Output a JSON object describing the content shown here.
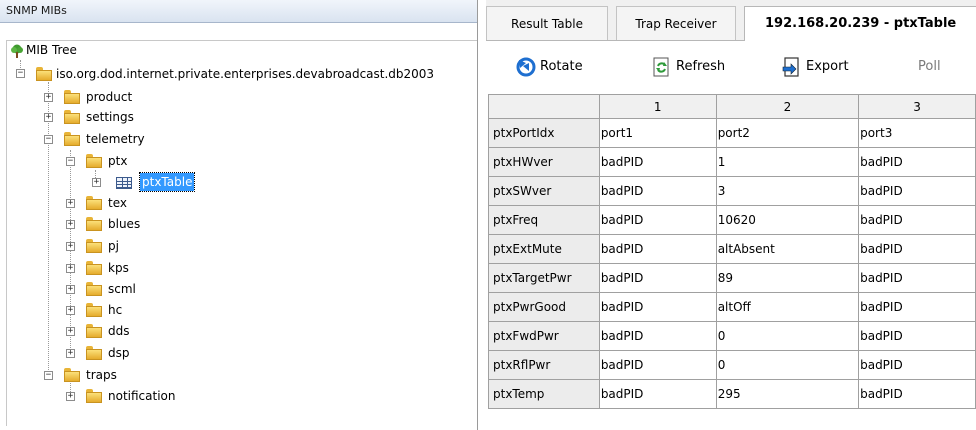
{
  "left_panel": {
    "title": "SNMP MIBs",
    "root_label": "MIB Tree",
    "tree": [
      {
        "label": "iso.org.dod.internet.private.enterprises.devabroadcast.db2003",
        "expander": "−"
      },
      {
        "label": "product",
        "expander": "+"
      },
      {
        "label": "settings",
        "expander": "+"
      },
      {
        "label": "telemetry",
        "expander": "−"
      },
      {
        "label": "ptx",
        "expander": "−"
      },
      {
        "label": "ptxTable",
        "expander": "+",
        "selected": true
      },
      {
        "label": "tex",
        "expander": "+"
      },
      {
        "label": "blues",
        "expander": "+"
      },
      {
        "label": "pj",
        "expander": "+"
      },
      {
        "label": "kps",
        "expander": "+"
      },
      {
        "label": "scml",
        "expander": "+"
      },
      {
        "label": "hc",
        "expander": "+"
      },
      {
        "label": "dds",
        "expander": "+"
      },
      {
        "label": "dsp",
        "expander": "+"
      },
      {
        "label": "traps",
        "expander": "−"
      },
      {
        "label": "notification",
        "expander": "+"
      }
    ]
  },
  "tabs": [
    {
      "label": "Result Table",
      "active": false
    },
    {
      "label": "Trap Receiver",
      "active": false
    },
    {
      "label": "192.168.20.239 - ptxTable",
      "active": true
    }
  ],
  "toolbar": {
    "rotate_label": "Rotate",
    "refresh_label": "Refresh",
    "export_label": "Export",
    "poll_label": "Poll"
  },
  "icons": {
    "tree_root": "tree-icon",
    "folder": "folder-icon",
    "table": "table-icon",
    "rotate": "rotate-icon",
    "refresh": "refresh-icon",
    "export": "export-icon"
  },
  "colors": {
    "selection": "#3399ff",
    "header_bg": "#f0f0f0",
    "rotate_blue": "#1e6fd0",
    "refresh_green": "#2e9a3a"
  },
  "grid": {
    "columns": [
      "1",
      "2",
      "3"
    ],
    "rows": [
      {
        "name": "ptxPortIdx",
        "cells": [
          "port1",
          "port2",
          "port3"
        ]
      },
      {
        "name": "ptxHWver",
        "cells": [
          "badPID",
          "1",
          "badPID"
        ]
      },
      {
        "name": "ptxSWver",
        "cells": [
          "badPID",
          "3",
          "badPID"
        ]
      },
      {
        "name": "ptxFreq",
        "cells": [
          "badPID",
          "10620",
          "badPID"
        ]
      },
      {
        "name": "ptxExtMute",
        "cells": [
          "badPID",
          "altAbsent",
          "badPID"
        ]
      },
      {
        "name": "ptxTargetPwr",
        "cells": [
          "badPID",
          "89",
          "badPID"
        ]
      },
      {
        "name": "ptxPwrGood",
        "cells": [
          "badPID",
          "altOff",
          "badPID"
        ]
      },
      {
        "name": "ptxFwdPwr",
        "cells": [
          "badPID",
          "0",
          "badPID"
        ]
      },
      {
        "name": "ptxRflPwr",
        "cells": [
          "badPID",
          "0",
          "badPID"
        ]
      },
      {
        "name": "ptxTemp",
        "cells": [
          "badPID",
          "295",
          "badPID"
        ]
      }
    ]
  }
}
